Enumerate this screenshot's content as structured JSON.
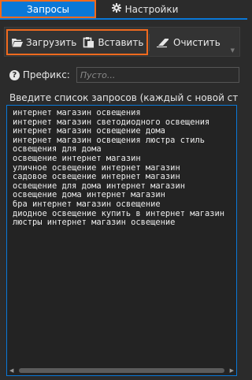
{
  "tabs": [
    {
      "label": "Запросы",
      "active": true
    },
    {
      "label": "Настройки",
      "icon": "gear-icon",
      "active": false
    }
  ],
  "toolbar": {
    "load_label": "Загрузить",
    "paste_label": "Вставить",
    "clear_label": "Очистить",
    "load_icon": "folder-open-icon",
    "paste_icon": "clipboard-icon",
    "clear_icon": "eraser-icon"
  },
  "prefix": {
    "label": "Префикс:",
    "placeholder": "Пусто...",
    "value": "",
    "help_icon": "help-icon"
  },
  "queries": {
    "label": "Введите список запросов (каждый с новой ст...",
    "lines": [
      "интернет магазин освещения",
      "интернет магазин светодиодного освещения",
      "интернет магазин освещение дома",
      "интернет магазин освещения люстра стиль",
      "освещения для дома",
      "освещение интернет магазин",
      "уличное освещение интернет магазин",
      "садовое освещение интернет магазин",
      "освещение для дома интернет магазин",
      "освещение дома интернет магазин",
      "бра интернет магазин освещение",
      "диодное освещение купить в интернет магазин",
      "люстры интернет магазин освещение"
    ]
  },
  "colors": {
    "accent": "#0a78d7",
    "highlight": "#f06a1e",
    "background": "#2b2b2b"
  }
}
